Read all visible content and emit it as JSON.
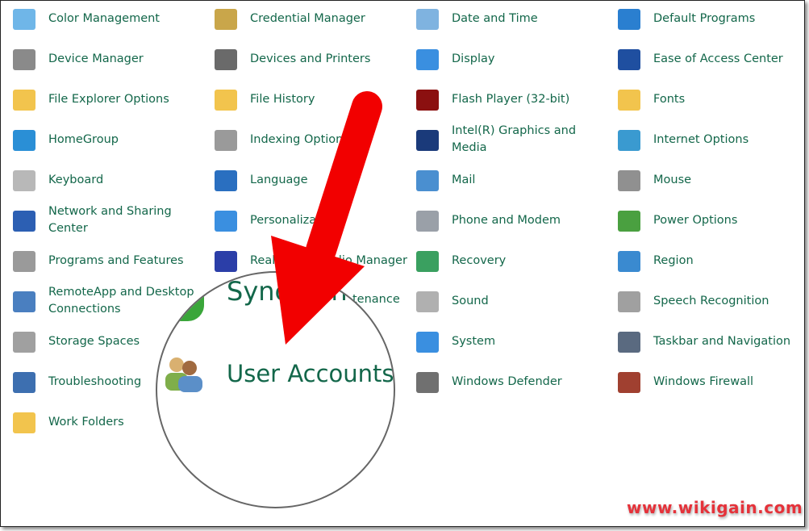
{
  "columns": [
    {
      "items": [
        {
          "label": "Color Management",
          "icon": "color-management-icon",
          "color": "#6fb6e8"
        },
        {
          "label": "Device Manager",
          "icon": "device-manager-icon",
          "color": "#8a8a8a"
        },
        {
          "label": "File Explorer Options",
          "icon": "folder-options-icon",
          "color": "#f2c44d"
        },
        {
          "label": "HomeGroup",
          "icon": "homegroup-icon",
          "color": "#2a8fd6"
        },
        {
          "label": "Keyboard",
          "icon": "keyboard-icon",
          "color": "#b8b8b8"
        },
        {
          "label": "Network and Sharing Center",
          "icon": "network-icon",
          "color": "#2c5fb3"
        },
        {
          "label": "Programs and Features",
          "icon": "programs-icon",
          "color": "#9a9a9a"
        },
        {
          "label": "RemoteApp and Desktop Connections",
          "icon": "remoteapp-icon",
          "color": "#4a7fc0"
        },
        {
          "label": "Storage Spaces",
          "icon": "storage-spaces-icon",
          "color": "#a0a0a0"
        },
        {
          "label": "Troubleshooting",
          "icon": "troubleshooting-icon",
          "color": "#3d6fb0"
        },
        {
          "label": "Work Folders",
          "icon": "work-folders-icon",
          "color": "#f2c44d"
        }
      ]
    },
    {
      "items": [
        {
          "label": "Credential Manager",
          "icon": "credential-manager-icon",
          "color": "#c9a64a"
        },
        {
          "label": "Devices and Printers",
          "icon": "printer-icon",
          "color": "#6a6a6a"
        },
        {
          "label": "File History",
          "icon": "file-history-icon",
          "color": "#f2c44d"
        },
        {
          "label": "Indexing Options",
          "icon": "indexing-icon",
          "color": "#9a9a9a"
        },
        {
          "label": "Language",
          "icon": "language-icon",
          "color": "#2a6fc0"
        },
        {
          "label": "Personalization",
          "icon": "personalization-icon",
          "color": "#3a8fe0"
        },
        {
          "label": "Realtek HD Audio Manager",
          "icon": "audio-manager-icon",
          "color": "#2b3ea8"
        }
      ]
    },
    {
      "items": [
        {
          "label": "Date and Time",
          "icon": "calendar-icon",
          "color": "#7fb3e0"
        },
        {
          "label": "Display",
          "icon": "display-icon",
          "color": "#3a8fe0"
        },
        {
          "label": "Flash Player (32-bit)",
          "icon": "flash-icon",
          "color": "#8b1010"
        },
        {
          "label": "Intel(R) Graphics and Media",
          "icon": "intel-graphics-icon",
          "color": "#1a3a7a"
        },
        {
          "label": "Mail",
          "icon": "mail-icon",
          "color": "#4a8fd0"
        },
        {
          "label": "Phone and Modem",
          "icon": "phone-icon",
          "color": "#9aa0a8"
        },
        {
          "label": "Recovery",
          "icon": "recovery-icon",
          "color": "#3aa060"
        },
        {
          "label": "Sound",
          "icon": "speaker-icon",
          "color": "#b0b0b0"
        },
        {
          "label": "System",
          "icon": "system-icon",
          "color": "#3a8fe0"
        },
        {
          "label": "Windows Defender",
          "icon": "defender-icon",
          "color": "#707070"
        }
      ]
    },
    {
      "items": [
        {
          "label": "Default Programs",
          "icon": "default-programs-icon",
          "color": "#2a7fd0"
        },
        {
          "label": "Ease of Access Center",
          "icon": "ease-of-access-icon",
          "color": "#1f4fa0"
        },
        {
          "label": "Fonts",
          "icon": "fonts-icon",
          "color": "#f2c44d"
        },
        {
          "label": "Internet Options",
          "icon": "internet-options-icon",
          "color": "#3a9ad0"
        },
        {
          "label": "Mouse",
          "icon": "mouse-icon",
          "color": "#909090"
        },
        {
          "label": "Power Options",
          "icon": "power-icon",
          "color": "#4aa040"
        },
        {
          "label": "Region",
          "icon": "region-icon",
          "color": "#3a8ad0"
        },
        {
          "label": "Speech Recognition",
          "icon": "microphone-icon",
          "color": "#a0a0a0"
        },
        {
          "label": "Taskbar and Navigation",
          "icon": "taskbar-icon",
          "color": "#5a6a80"
        },
        {
          "label": "Windows Firewall",
          "icon": "firewall-icon",
          "color": "#a04030"
        }
      ]
    }
  ],
  "fragment": "tenance",
  "magnifier": {
    "sync": "Sync Cente",
    "user_accounts": "User Accounts"
  },
  "watermark": "www.wikigain.com",
  "arrow_color": "#f20000"
}
